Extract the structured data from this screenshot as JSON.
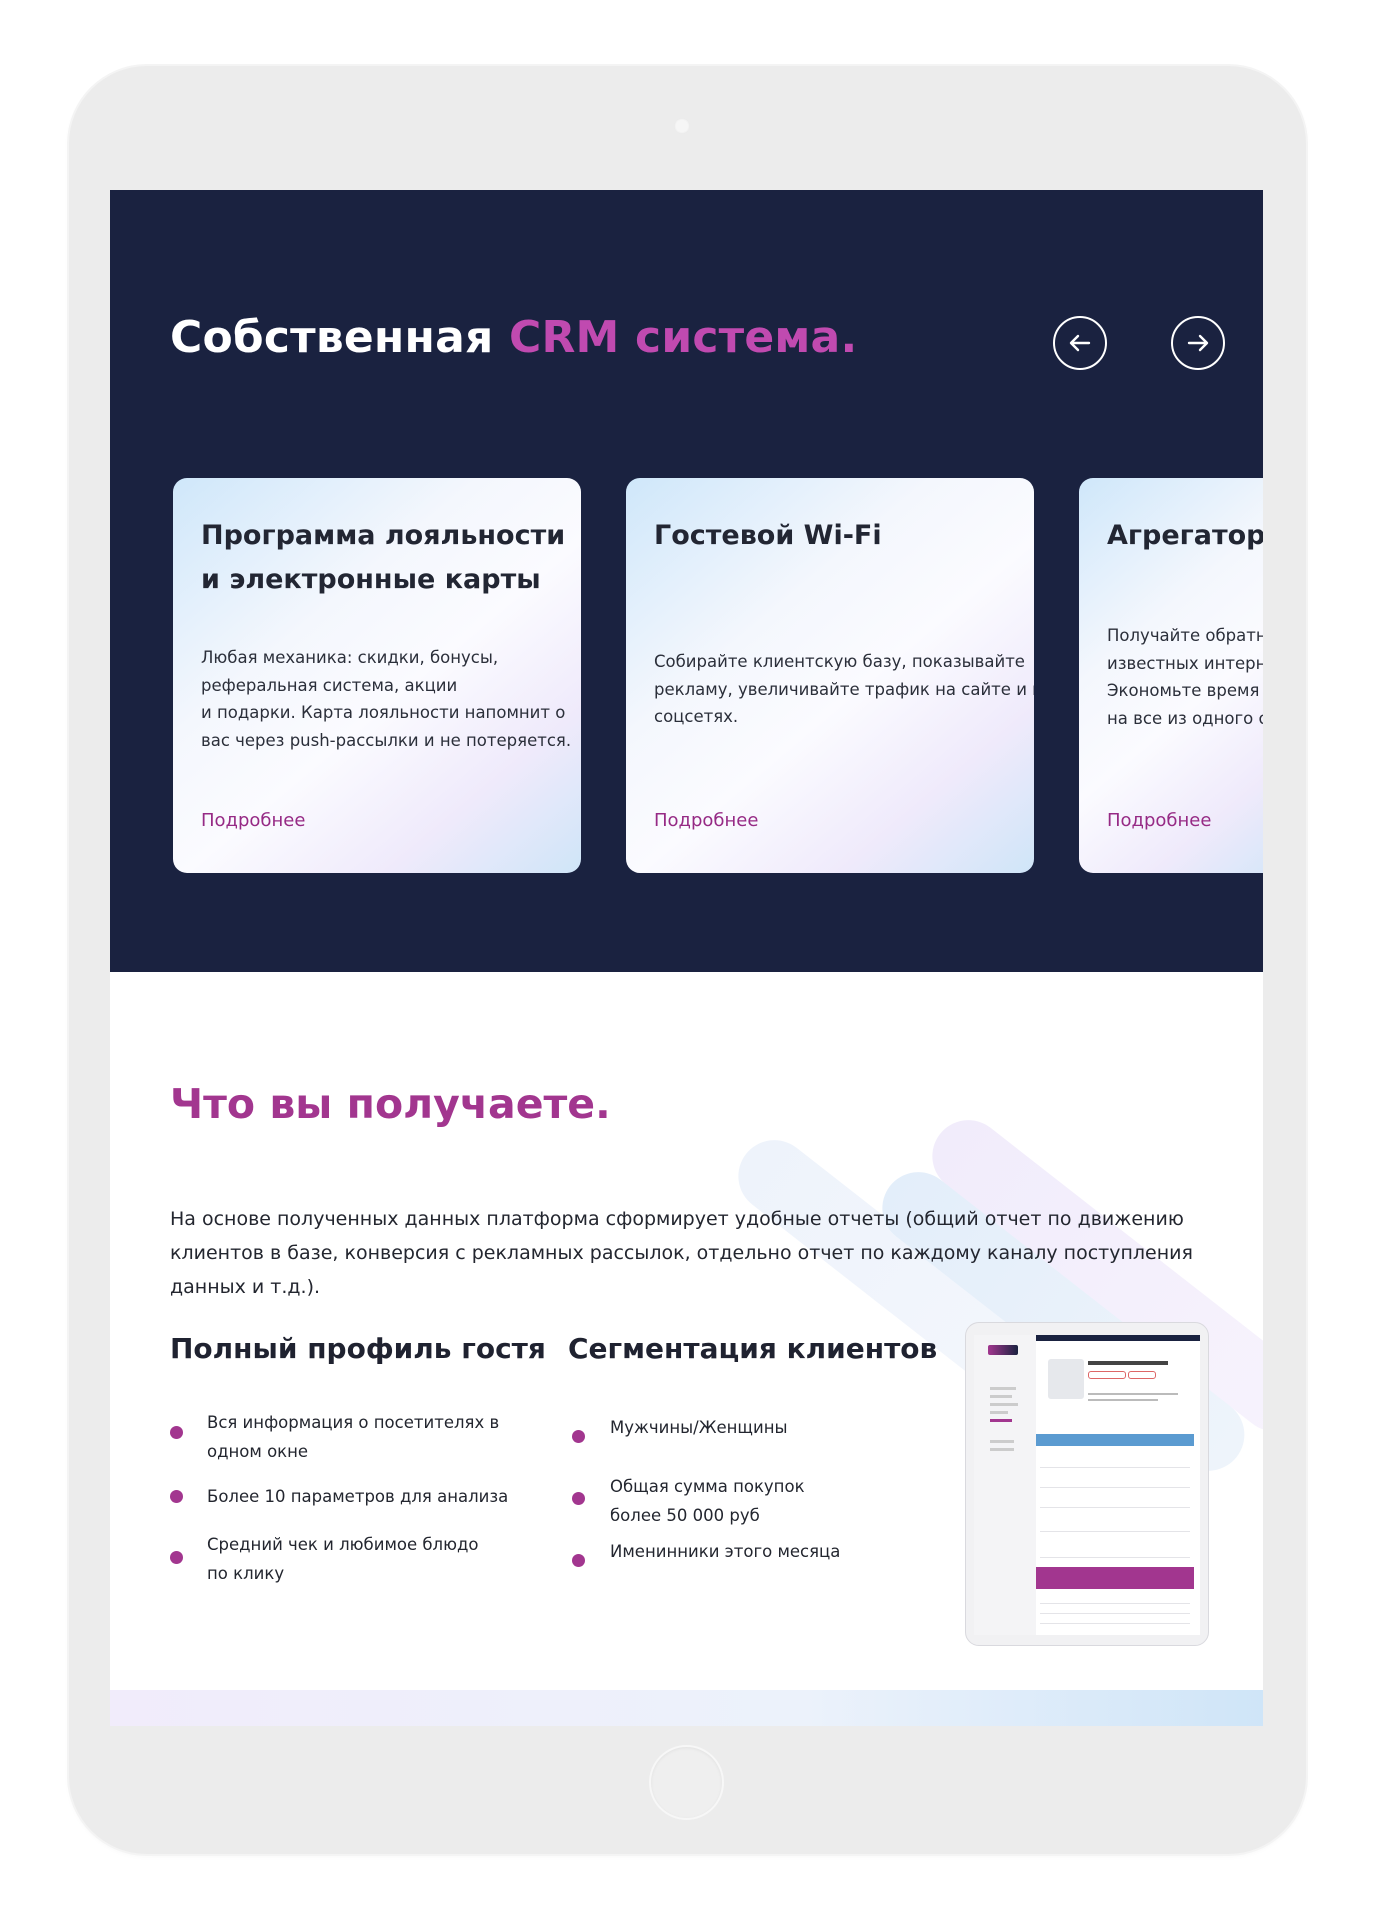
{
  "hero": {
    "title_main": "Собственная ",
    "title_accent": "CRM система.",
    "prev_icon": "arrow-left-circle-icon",
    "next_icon": "arrow-right-circle-icon"
  },
  "cards": [
    {
      "title_lines": [
        "Программа лояльности",
        "и электронные карты"
      ],
      "text_lines": [
        "Любая механика: скидки, бонусы,",
        "реферальная система, акции",
        "и подарки. Карта лояльности напомнит о",
        "вас через push-рассылки и не потеряется."
      ],
      "link": "Подробнее"
    },
    {
      "title_lines": [
        "Гостевой Wi-Fi"
      ],
      "text_lines": [
        "Собирайте клиентскую базу, показывайте",
        "рекламу, увеличивайте трафик на сайте и в",
        "соцсетях."
      ],
      "link": "Подробнее"
    },
    {
      "title_lines": [
        "Агрегатор"
      ],
      "text_lines": [
        "Получайте обратну",
        "известных интернет",
        "Экономьте время и",
        "на все из одного ок"
      ],
      "link": "Подробнее"
    }
  ],
  "benefits": {
    "title": "Что вы получаете.",
    "description": "На основе полученных данных платформа сформирует удобные отчеты (общий отчет по движению клиентов в базе, конверсия с рекламных рассылок, отдельно отчет по каждому каналу поступления данных и т.д.).",
    "profile": {
      "title": "Полный профиль гостя",
      "items": [
        [
          "Вся информация о посетителях в",
          "одном окне"
        ],
        [
          "Более 10 параметров для анализа"
        ],
        [
          "Средний чек и любимое блюдо",
          "по клику"
        ]
      ]
    },
    "segmentation": {
      "title": "Сегментация клиентов",
      "items": [
        [
          "Мужчины/Женщины"
        ],
        [
          "Общая сумма покупок",
          "более 50 000 руб"
        ],
        [
          "Именинники этого месяца"
        ]
      ]
    }
  },
  "colors": {
    "hero_bg": "#1a2240",
    "accent": "#c04ab0",
    "heading_accent": "#a2368f",
    "link": "#962a85"
  }
}
